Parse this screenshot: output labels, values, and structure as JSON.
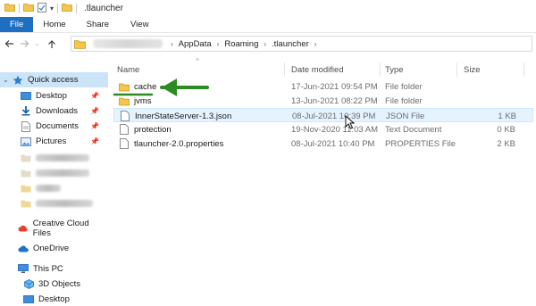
{
  "window": {
    "title": ".tlauncher"
  },
  "ribbon": {
    "tabs": [
      "File",
      "Home",
      "Share",
      "View"
    ]
  },
  "address": {
    "crumbs": [
      "AppData",
      "Roaming",
      ".tlauncher"
    ]
  },
  "sidebar": {
    "quick_access": "Quick access",
    "items": [
      "Desktop",
      "Downloads",
      "Documents",
      "Pictures"
    ],
    "creative_cloud": "Creative Cloud Files",
    "onedrive": "OneDrive",
    "this_pc": "This PC",
    "pc_items": [
      "3D Objects",
      "Desktop"
    ]
  },
  "columns": {
    "name": "Name",
    "date": "Date modified",
    "type": "Type",
    "size": "Size"
  },
  "files": [
    {
      "name": "cache",
      "date": "17-Jun-2021 09:54 PM",
      "type": "File folder",
      "size": "",
      "kind": "folder"
    },
    {
      "name": "jvms",
      "date": "13-Jun-2021 08:22 PM",
      "type": "File folder",
      "size": "",
      "kind": "folder"
    },
    {
      "name": "InnerStateServer-1.3.json",
      "date": "08-Jul-2021 10:39 PM",
      "type": "JSON File",
      "size": "1 KB",
      "kind": "file"
    },
    {
      "name": "protection",
      "date": "19-Nov-2020 11:03 AM",
      "type": "Text Document",
      "size": "0 KB",
      "kind": "file"
    },
    {
      "name": "tlauncher-2.0.properties",
      "date": "08-Jul-2021 10:40 PM",
      "type": "PROPERTIES File",
      "size": "2 KB",
      "kind": "file"
    }
  ],
  "colors": {
    "accent": "#1e6fc2",
    "selection": "#cce4f7",
    "hover": "#e5f3ff",
    "folder": "#f4c64c",
    "annotation": "#2e8b23"
  }
}
